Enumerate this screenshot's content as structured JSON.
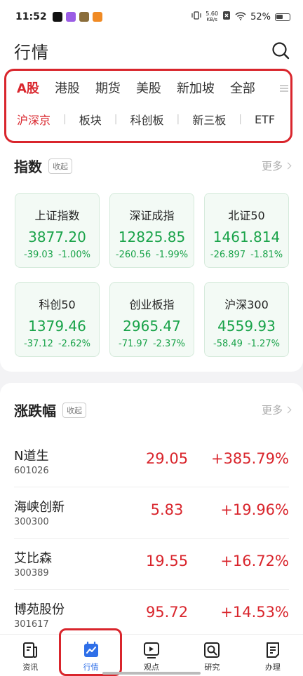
{
  "status_bar": {
    "time": "11:52",
    "net_speed_value": "5.60",
    "net_speed_unit": "KB/s",
    "battery": "52%"
  },
  "header": {
    "title": "行情"
  },
  "market_tabs": [
    "A股",
    "港股",
    "期货",
    "美股",
    "新加坡",
    "全部"
  ],
  "sub_tabs": [
    "沪深京",
    "板块",
    "科创板",
    "新三板",
    "ETF"
  ],
  "index_section": {
    "title": "指数",
    "collapse_label": "收起",
    "more_label": "更多",
    "tiles": [
      {
        "name": "上证指数",
        "value": "3877.20",
        "change": "-39.03",
        "pct": "-1.00%"
      },
      {
        "name": "深证成指",
        "value": "12825.85",
        "change": "-260.56",
        "pct": "-1.99%"
      },
      {
        "name": "北证50",
        "value": "1461.814",
        "change": "-26.897",
        "pct": "-1.81%"
      },
      {
        "name": "科创50",
        "value": "1379.46",
        "change": "-37.12",
        "pct": "-2.62%"
      },
      {
        "name": "创业板指",
        "value": "2965.47",
        "change": "-71.97",
        "pct": "-2.37%"
      },
      {
        "name": "沪深300",
        "value": "4559.93",
        "change": "-58.49",
        "pct": "-1.27%"
      }
    ]
  },
  "movers_section": {
    "title": "涨跌幅",
    "collapse_label": "收起",
    "more_label": "更多",
    "rows": [
      {
        "name": "N道生",
        "code": "601026",
        "price": "29.05",
        "pct": "+385.79%"
      },
      {
        "name": "海峡创新",
        "code": "300300",
        "price": "5.83",
        "pct": "+19.96%"
      },
      {
        "name": "艾比森",
        "code": "300389",
        "price": "19.55",
        "pct": "+16.72%"
      },
      {
        "name": "博苑股份",
        "code": "301617",
        "price": "95.72",
        "pct": "+14.53%"
      }
    ]
  },
  "bottom_nav": [
    {
      "label": "资讯",
      "icon": "news-icon"
    },
    {
      "label": "行情",
      "icon": "market-chart-icon"
    },
    {
      "label": "观点",
      "icon": "video-play-icon"
    },
    {
      "label": "研究",
      "icon": "research-search-icon"
    },
    {
      "label": "办理",
      "icon": "document-list-icon"
    }
  ],
  "colors": {
    "accent_red": "#d9252c",
    "fall_green": "#1aa34a",
    "active_blue": "#2f6fe8"
  }
}
